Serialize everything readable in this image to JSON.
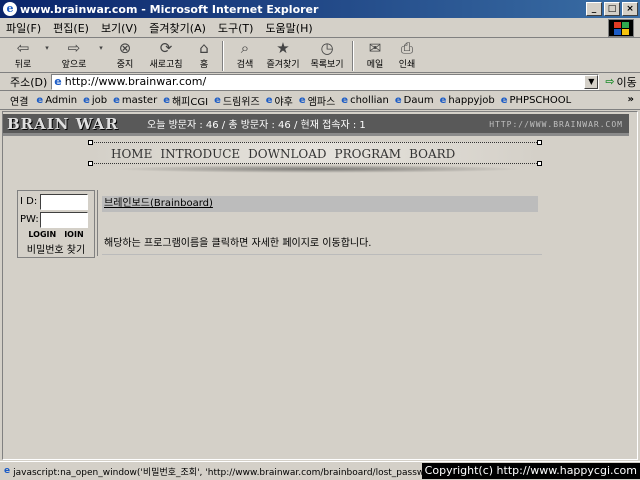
{
  "window": {
    "title": "www.brainwar.com - Microsoft Internet Explorer",
    "min": "_",
    "max": "□",
    "close": "×"
  },
  "menu": [
    "파일(F)",
    "편집(E)",
    "보기(V)",
    "즐겨찾기(A)",
    "도구(T)",
    "도움말(H)"
  ],
  "toolbar": [
    {
      "icon": "⇦",
      "label": "뒤로"
    },
    {
      "icon": "⇨",
      "label": "앞으로"
    },
    {
      "icon": "⊗",
      "label": "중지"
    },
    {
      "icon": "⟳",
      "label": "새로고침"
    },
    {
      "icon": "⌂",
      "label": "홈"
    },
    {
      "icon": "⌕",
      "label": "검색"
    },
    {
      "icon": "★",
      "label": "즐겨찾기"
    },
    {
      "icon": "◷",
      "label": "목록보기"
    },
    {
      "icon": "✉",
      "label": "메일"
    },
    {
      "icon": "⎙",
      "label": "인쇄"
    }
  ],
  "address": {
    "label": "주소(D)",
    "value": "http://www.brainwar.com/",
    "go": "이동"
  },
  "links": {
    "label": "연결",
    "items": [
      "Admin",
      "job",
      "master",
      "해피CGI",
      "드림위즈",
      "야후",
      "엠파스",
      "chollian",
      "Daum",
      "happyjob",
      "PHPSCHOOL"
    ]
  },
  "site": {
    "logo": "BRAIN WAR",
    "visitors": "오늘 방문자 : 46 / 총 방문자 : 46 / 현재 접속자 : 1",
    "url": "HTTP://WWW.BRAINWAR.COM",
    "nav": [
      "HOME",
      "INTRODUCE",
      "DOWNLOAD",
      "PROGRAM",
      "BOARD"
    ]
  },
  "login": {
    "id_label": "I D:",
    "pw_label": "PW:",
    "login": "LOGIN",
    "join": "IOIN",
    "find_pw": "비밀번호 찾기"
  },
  "board": {
    "title": "브레인보드(Brainboard)",
    "desc": "해당하는 프로그램이름을 클릭하면 자세한 페이지로 이동합니다."
  },
  "status": {
    "text": "javascript:na_open_window('비밀번호_조회', 'http://www.brainwar.com/brainboard/lost_password"
  },
  "copyright": "Copyright(c) http://www.happycgi.com"
}
